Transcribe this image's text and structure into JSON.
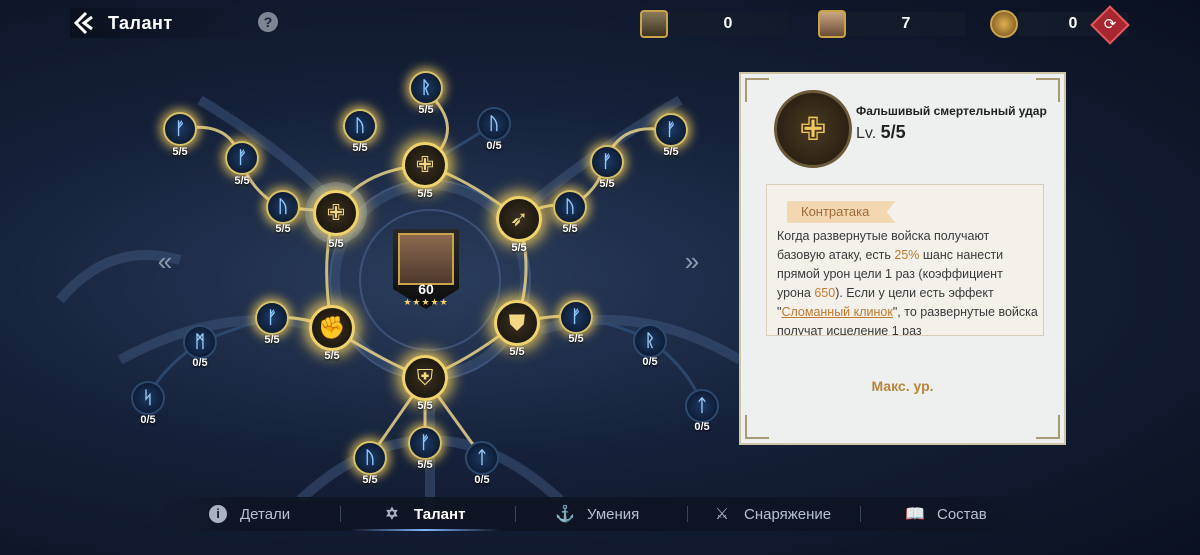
{
  "header": {
    "title": "Талант",
    "help": "?"
  },
  "resources": [
    {
      "name": "soldier-token",
      "value": "0"
    },
    {
      "name": "hero-token",
      "value": "7"
    },
    {
      "name": "talent-token",
      "value": "0"
    }
  ],
  "hero": {
    "level": "60",
    "stars": "★★★★★"
  },
  "talent_nodes": [
    {
      "id": "n1",
      "glyph": "ᚱ",
      "level": "5/5"
    },
    {
      "id": "n2",
      "glyph": "ᚠ",
      "level": "5/5"
    },
    {
      "id": "n3",
      "glyph": "ᚢ",
      "level": "5/5"
    },
    {
      "id": "n4",
      "glyph": "ᚠ",
      "level": "5/5"
    },
    {
      "id": "n5",
      "glyph": "ᚢ",
      "level": "5/5"
    },
    {
      "id": "n6",
      "glyph": "ᚢ",
      "level": "0/5"
    },
    {
      "id": "n7",
      "glyph": "ᚠ",
      "level": "5/5"
    },
    {
      "id": "n8",
      "glyph": "ᚠ",
      "level": "5/5"
    },
    {
      "id": "n9",
      "glyph": "ᚢ",
      "level": "5/5"
    },
    {
      "id": "n10",
      "glyph": "ᛗ",
      "level": "0/5"
    },
    {
      "id": "n11",
      "glyph": "ᛋ",
      "level": "0/5"
    },
    {
      "id": "n12",
      "glyph": "ᚠ",
      "level": "5/5"
    },
    {
      "id": "n13",
      "glyph": "ᚠ",
      "level": "5/5"
    },
    {
      "id": "n14",
      "glyph": "ᚱ",
      "level": "0/5"
    },
    {
      "id": "n15",
      "glyph": "ᛏ",
      "level": "0/5"
    },
    {
      "id": "n16",
      "glyph": "ᚢ",
      "level": "5/5"
    },
    {
      "id": "n17",
      "glyph": "ᚠ",
      "level": "5/5"
    },
    {
      "id": "n18",
      "glyph": "ᛏ",
      "level": "0/5"
    }
  ],
  "big_nodes": [
    {
      "id": "b1",
      "icon": "✙",
      "level": "5/5"
    },
    {
      "id": "b2",
      "icon": "✙",
      "level": "5/5"
    },
    {
      "id": "b3",
      "icon": "➶",
      "level": "5/5"
    },
    {
      "id": "b4",
      "icon": "✊",
      "level": "5/5"
    },
    {
      "id": "b5",
      "icon": "⛊",
      "level": "5/5"
    },
    {
      "id": "b6",
      "icon": "⛨",
      "level": "5/5"
    }
  ],
  "detail": {
    "name": "Фальшивый смертельный удар",
    "lv_label": "Lv.",
    "lv_value": "5/5",
    "tag": "Контратака",
    "desc_1": "Когда развернутые войска получают базовую атаку, есть ",
    "chance": "25%",
    "desc_2": " шанс нанести прямой урон цели 1 раз (коэффициент урона ",
    "coef": "650",
    "desc_3": "). Если у цели есть эффект \"",
    "effect": "Сломанный клинок",
    "desc_4": "\", то развернутые войска получат исцеление 1 раз",
    "max_label": "Макс. ур."
  },
  "tabs": [
    {
      "label": "Детали",
      "icon": "info-icon"
    },
    {
      "label": "Талант",
      "icon": "talent-icon"
    },
    {
      "label": "Умения",
      "icon": "anchor-icon"
    },
    {
      "label": "Снаряжение",
      "icon": "equipment-icon"
    },
    {
      "label": "Состав",
      "icon": "book-icon"
    }
  ],
  "colors": {
    "gold": "#f1d36e",
    "accent_orange": "#c07a2e",
    "panel_bg": "#eef0ef"
  }
}
